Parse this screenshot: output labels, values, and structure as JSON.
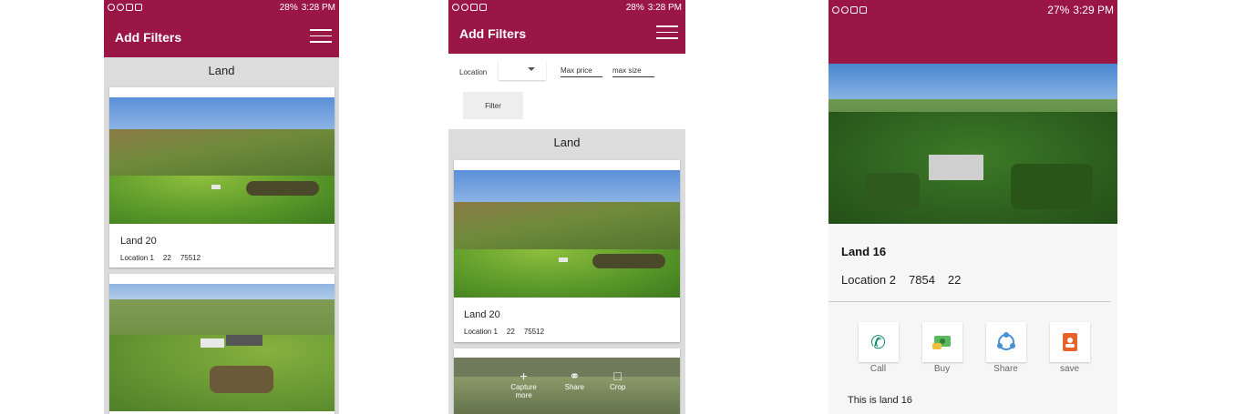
{
  "screen1": {
    "status": {
      "battery": "28%",
      "time": "3:28 PM"
    },
    "app_title": "Add Filters",
    "section": "Land",
    "cards": [
      {
        "title": "Land 20",
        "location": "Location 1",
        "size": "22",
        "price": "75512"
      }
    ]
  },
  "screen2": {
    "status": {
      "battery": "28%",
      "time": "3:28 PM"
    },
    "app_title": "Add Filters",
    "filters": {
      "location_label": "Location",
      "max_price_label": "Max price",
      "max_size_label": "max size",
      "filter_button": "Filter"
    },
    "section": "Land",
    "cards": [
      {
        "title": "Land 20",
        "location": "Location 1",
        "size": "22",
        "price": "75512"
      }
    ],
    "overlay": {
      "capture": "Capture more",
      "share": "Share",
      "crop": "Crop"
    }
  },
  "screen3": {
    "status": {
      "battery": "27%",
      "time": "3:29 PM"
    },
    "title": "Land 16",
    "location": "Location 2",
    "price": "7854",
    "size": "22",
    "actions": {
      "call": "Call",
      "buy": "Buy",
      "share": "Share",
      "save": "save"
    },
    "description": "This is land 16"
  },
  "colors": {
    "brand": "#9a1745",
    "call_icon": "#0f8a6a",
    "save_icon": "#e8632b"
  }
}
